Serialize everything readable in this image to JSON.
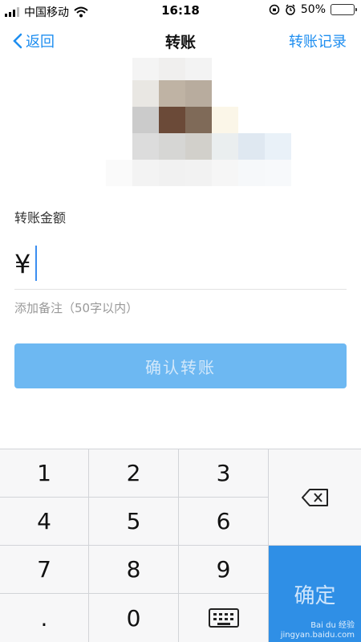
{
  "status_bar": {
    "carrier": "中国移动",
    "time": "16:18",
    "battery_percent": "50%",
    "battery_level": 0.5
  },
  "nav": {
    "back_label": "返回",
    "title": "转账",
    "records_label": "转账记录"
  },
  "transfer": {
    "amount_label": "转账金额",
    "currency_symbol": "¥",
    "amount_value": "",
    "note_placeholder": "添加备注（50字以内）",
    "confirm_label": "确认转账"
  },
  "keypad": {
    "keys": [
      "1",
      "2",
      "3",
      "4",
      "5",
      "6",
      "7",
      "8",
      "9",
      ".",
      "0"
    ],
    "confirm_label": "确定",
    "hide_keyboard_icon": "keyboard-icon",
    "delete_icon": "backspace-icon"
  },
  "watermark": {
    "brand": "Bai du 经验",
    "url": "jingyan.baidu.com"
  },
  "colors": {
    "accent": "#1e8ef0",
    "confirm_disabled": "#6db8f2",
    "keypad_confirm": "#2f8fe6"
  }
}
